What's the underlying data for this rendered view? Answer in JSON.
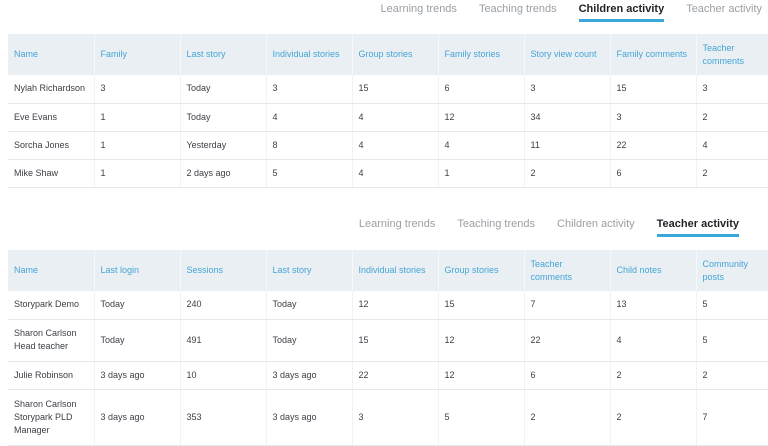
{
  "top_tabs": [
    "Learning trends",
    "Teaching trends",
    "Children activity",
    "Teacher activity"
  ],
  "children_table": {
    "headers": [
      "Name",
      "Family",
      "Last story",
      "Individual stories",
      "Group stories",
      "Family stories",
      "Story view count",
      "Family comments",
      "Teacher comments"
    ],
    "rows": [
      [
        "Nylah Richardson",
        "3",
        "Today",
        "3",
        "15",
        "6",
        "3",
        "15",
        "3"
      ],
      [
        "Eve Evans",
        "1",
        "Today",
        "4",
        "4",
        "12",
        "34",
        "3",
        "2"
      ],
      [
        "Sorcha Jones",
        "1",
        "Yesterday",
        "8",
        "4",
        "4",
        "11",
        "22",
        "4"
      ],
      [
        "Mike Shaw",
        "1",
        "2 days ago",
        "5",
        "4",
        "1",
        "2",
        "6",
        "2"
      ]
    ]
  },
  "bottom_tabs": [
    "Learning trends",
    "Teaching trends",
    "Children activity",
    "Teacher activity"
  ],
  "teacher_table": {
    "headers": [
      "Name",
      "Last login",
      "Sessions",
      "Last story",
      "Individual stories",
      "Group stories",
      "Teacher comments",
      "Child notes",
      "Community posts"
    ],
    "rows": [
      [
        "Storypark Demo",
        "Today",
        "240",
        "Today",
        "12",
        "15",
        "7",
        "13",
        "5"
      ],
      [
        "Sharon Carlson Head teacher",
        "Today",
        "491",
        "Today",
        "15",
        "12",
        "22",
        "4",
        "5"
      ],
      [
        "Julie Robinson",
        "3 days ago",
        "10",
        "3 days ago",
        "22",
        "12",
        "6",
        "2",
        "2"
      ],
      [
        "Sharon Carlson Storypark PLD Manager",
        "3 days ago",
        "353",
        "3 days ago",
        "3",
        "5",
        "2",
        "2",
        "7"
      ]
    ]
  }
}
